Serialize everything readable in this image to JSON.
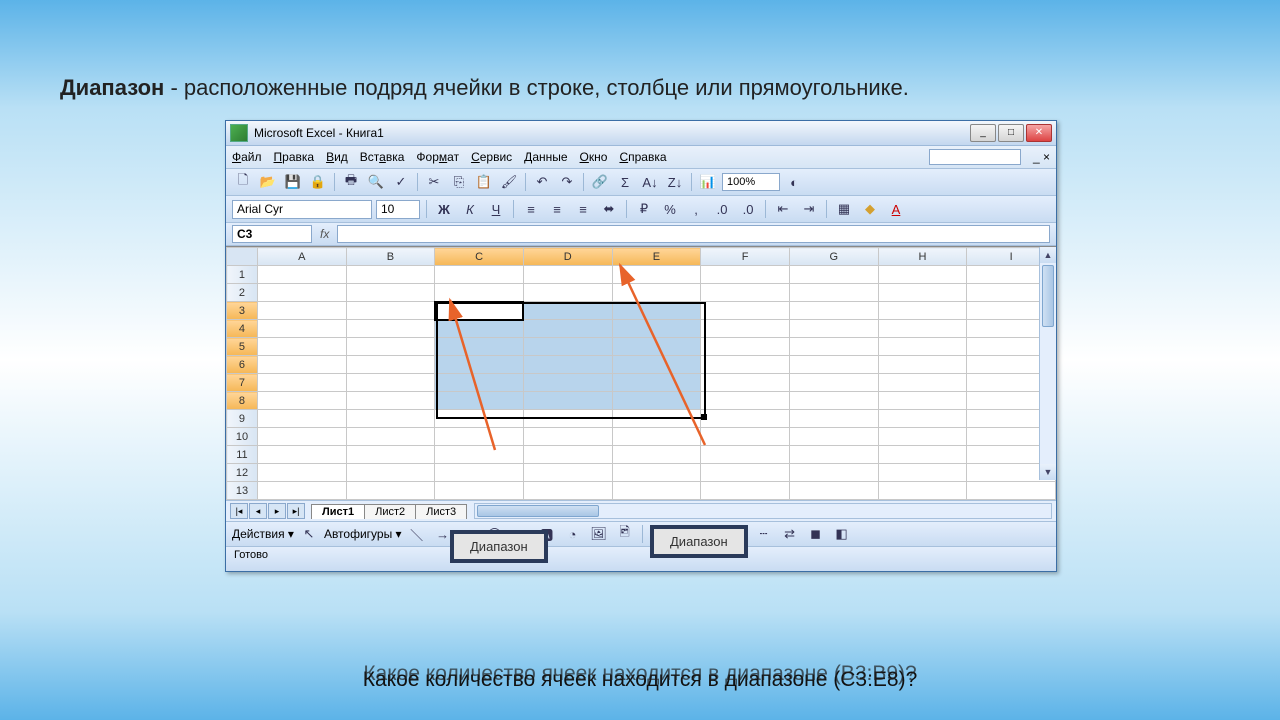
{
  "heading_bold": "Диапазон",
  "heading_rest": " - расположенные подряд ячейки в строке, столбце или прямоугольнике.",
  "window_title": "Microsoft Excel - Книга1",
  "menu": [
    "Файл",
    "Правка",
    "Вид",
    "Вставка",
    "Формат",
    "Сервис",
    "Данные",
    "Окно",
    "Справка"
  ],
  "zoom": "100%",
  "font_name": "Arial Cyr",
  "font_size": "10",
  "bold": "Ж",
  "italic": "К",
  "underline": "Ч",
  "name_box": "C3",
  "columns": [
    "A",
    "B",
    "C",
    "D",
    "E",
    "F",
    "G",
    "H",
    "I"
  ],
  "rows": [
    "1",
    "2",
    "3",
    "4",
    "5",
    "6",
    "7",
    "8",
    "9",
    "10",
    "11",
    "12",
    "13"
  ],
  "sheets": [
    "Лист1",
    "Лист2",
    "Лист3"
  ],
  "draw_actions": "Действия",
  "draw_autoshapes": "Автофигуры",
  "status": "Готово",
  "callout1": "Диапазон",
  "callout2": "Диапазон",
  "question1": "Какое количество ячеек находится в диапазоне (B3:B9)?",
  "question2": "Какое количество ячеек находится в диапазоне (C3:E8)?"
}
